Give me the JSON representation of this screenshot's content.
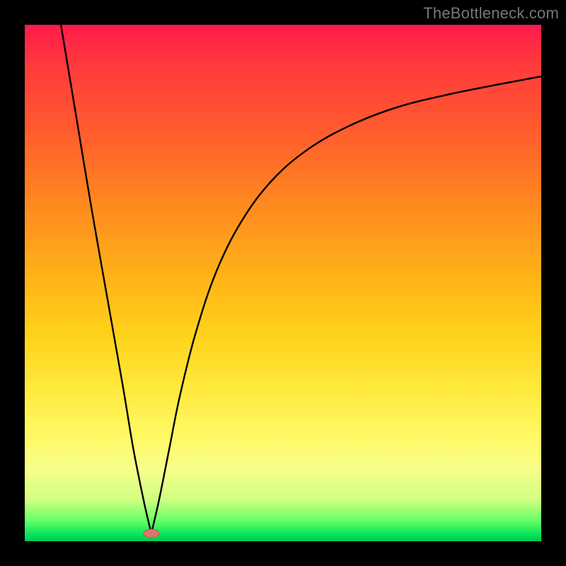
{
  "watermark": "TheBottleneck.com",
  "chart_data": {
    "type": "line",
    "title": "",
    "xlabel": "",
    "ylabel": "",
    "xlim": [
      0,
      100
    ],
    "ylim": [
      0,
      100
    ],
    "grid": false,
    "legend": false,
    "annotations": [
      {
        "name": "marker",
        "shape": "ellipse",
        "x": 24.5,
        "y": 1.5,
        "color": "#d9776b"
      }
    ],
    "series": [
      {
        "name": "left-branch",
        "x": [
          7,
          10,
          13,
          16,
          19,
          21,
          23,
          24.5
        ],
        "values": [
          100,
          82,
          64,
          47,
          30,
          18,
          8,
          1.5
        ]
      },
      {
        "name": "right-branch",
        "x": [
          24.5,
          26,
          28,
          30,
          33,
          37,
          42,
          48,
          55,
          63,
          72,
          82,
          92,
          100
        ],
        "values": [
          1.5,
          8,
          18,
          28,
          40,
          52,
          62,
          70,
          76,
          80.5,
          84,
          86.5,
          88.5,
          90
        ]
      }
    ]
  }
}
